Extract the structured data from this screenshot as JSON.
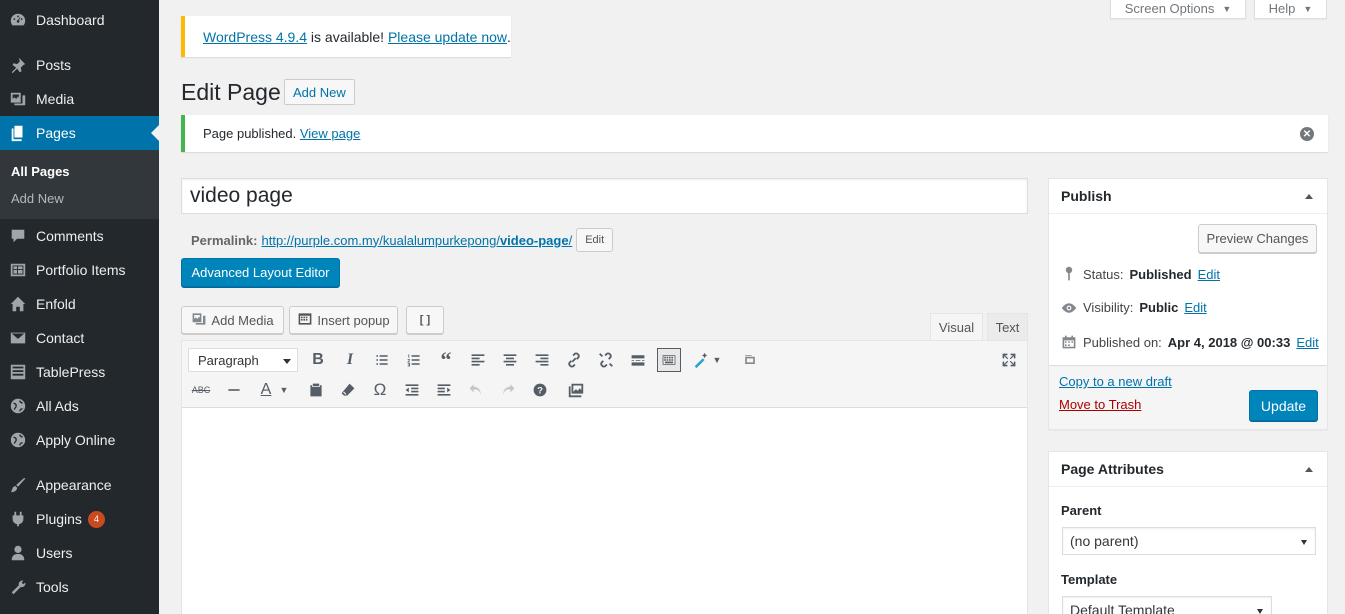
{
  "sidebar": {
    "items": [
      {
        "label": "Dashboard",
        "icon": "dashboard-icon"
      },
      {
        "label": "Posts",
        "icon": "pin-icon"
      },
      {
        "label": "Media",
        "icon": "media-icon"
      },
      {
        "label": "Pages",
        "icon": "pages-icon"
      },
      {
        "label": "Comments",
        "icon": "comment-icon"
      },
      {
        "label": "Portfolio Items",
        "icon": "portfolio-icon"
      },
      {
        "label": "Enfold",
        "icon": "home-icon"
      },
      {
        "label": "Contact",
        "icon": "mail-icon"
      },
      {
        "label": "TablePress",
        "icon": "table-icon"
      },
      {
        "label": "All Ads",
        "icon": "globe-icon"
      },
      {
        "label": "Apply Online",
        "icon": "globe-icon"
      },
      {
        "label": "Appearance",
        "icon": "brush-icon"
      },
      {
        "label": "Plugins",
        "icon": "plugin-icon",
        "badge": "4"
      },
      {
        "label": "Users",
        "icon": "user-icon"
      },
      {
        "label": "Tools",
        "icon": "wrench-icon"
      }
    ],
    "submenu": [
      "All Pages",
      "Add New"
    ]
  },
  "topbar": {
    "screen_options": "Screen Options",
    "help": "Help"
  },
  "update_notice": {
    "link1": "WordPress 4.9.4",
    "mid": " is available! ",
    "link2": "Please update now",
    "end": "."
  },
  "heading": {
    "title": "Edit Page",
    "add_new": "Add New"
  },
  "published_notice": {
    "text": "Page published. ",
    "link": "View page"
  },
  "post": {
    "title": "video page",
    "permalink_label": "Permalink:",
    "permalink_base": "http://purple.com.my/kualalumpurkepong/",
    "permalink_slug": "video-page",
    "permalink_end": "/",
    "permalink_edit": "Edit"
  },
  "buttons": {
    "advanced_layout_editor": "Advanced Layout Editor",
    "add_media": "Add Media",
    "insert_popup": "Insert popup",
    "shortcode": "[ ]"
  },
  "editor": {
    "tab_visual": "Visual",
    "tab_text": "Text",
    "format": "Paragraph"
  },
  "publish": {
    "title": "Publish",
    "preview": "Preview Changes",
    "status_label": "Status:",
    "status_value": "Published",
    "visibility_label": "Visibility:",
    "visibility_value": "Public",
    "published_label": "Published on:",
    "published_value": "Apr 4, 2018 @ 00:33",
    "edit": "Edit",
    "copy_draft": "Copy to a new draft",
    "trash": "Move to Trash",
    "update": "Update"
  },
  "attributes": {
    "title": "Page Attributes",
    "parent_label": "Parent",
    "parent_value": "(no parent)",
    "template_label": "Template",
    "template_value": "Default Template"
  },
  "colors": {
    "sidebar": "#23282d",
    "accent": "#0073aa",
    "primary_button": "#0085ba",
    "warning": "#ffb900",
    "success": "#46b450",
    "trash": "#a00",
    "badge": "#ca4a1f"
  }
}
